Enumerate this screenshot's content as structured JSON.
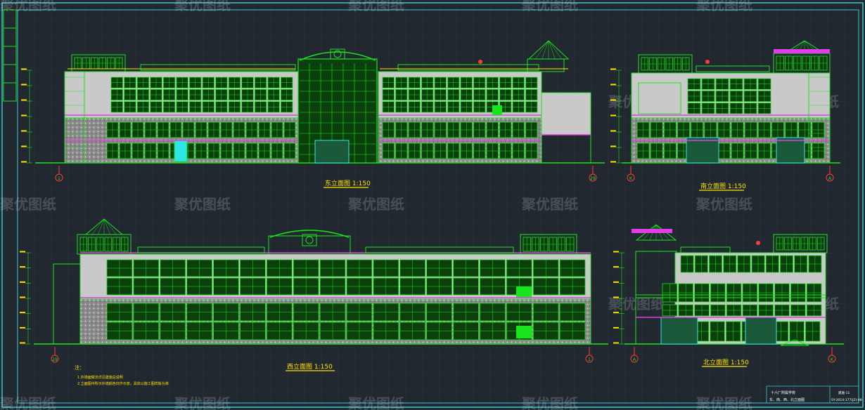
{
  "colors": {
    "background": "#212830",
    "grid": "#2a323b",
    "frame": "#39c6d6",
    "wall": "#c9c9c9",
    "green": "#19e51c",
    "yellow": "#ffe400",
    "magenta": "#e23ee6",
    "cyan": "#2ee6e6",
    "red": "#ff3b3b",
    "white": "#ffffff"
  },
  "watermark": "聚优图纸",
  "views": {
    "east": {
      "title": "东立面图 1:150",
      "axis_left": "1",
      "axis_right": "29"
    },
    "south": {
      "title": "南立面图 1:150",
      "axis_left": "K",
      "axis_right": "A"
    },
    "west": {
      "title": "西立面图 1:150",
      "axis_left": "29",
      "axis_right": "1"
    },
    "north": {
      "title": "北立面图 1:150",
      "axis_left": "A",
      "axis_right": "K"
    }
  },
  "notes": {
    "heading": "注：",
    "line1": "1.外墙面做法详见建施总说明",
    "line2": "2.立面图中所示外墙颜色仅作示意，具体以施工图样板为准"
  },
  "title_block": {
    "project": "十六厂附属学校",
    "drawing": "东、南、西、北立面图",
    "number": "建施-11",
    "code": "SY-2014-177(JZ)-08"
  }
}
